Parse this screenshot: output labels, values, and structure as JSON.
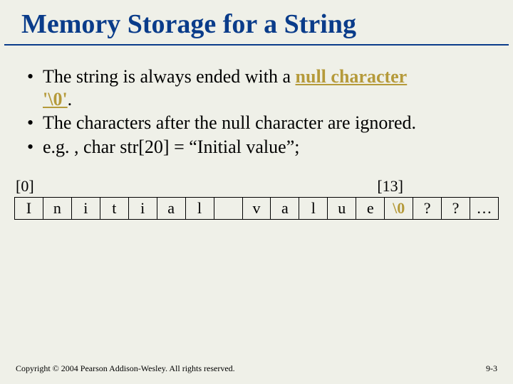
{
  "title": "Memory Storage for a String",
  "bullets": {
    "b1a": "The string is always ended with a ",
    "b1b": "null character",
    "b1c": "'\\0'",
    "b1d": ". ",
    "b2": "The characters after the null character are ignored.",
    "b3": "e.g. , char str[20] = “Initial value”;"
  },
  "indices": {
    "left": "[0]",
    "right": "[13]"
  },
  "cells": [
    "I",
    "n",
    "i",
    "t",
    "i",
    "a",
    "l",
    "",
    "v",
    "a",
    "l",
    "u",
    "e",
    "\\0",
    "?",
    "?",
    "…"
  ],
  "footer": {
    "copyright": "Copyright © 2004 Pearson Addison-Wesley. All rights reserved.",
    "page": "9-3"
  }
}
